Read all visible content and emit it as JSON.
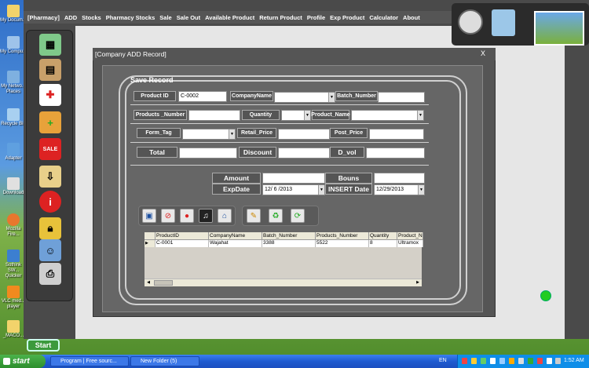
{
  "app_menu": [
    "[Pharmacy]",
    "ADD",
    "Stocks",
    "Pharmacy Stocks",
    "Sale",
    "Sale Out",
    "Available Product",
    "Return Product",
    "Profile",
    "Exp Product",
    "Calculator",
    "About"
  ],
  "desktop_icons": [
    "My Docum...",
    "My Compu...",
    "My Netwo... Places",
    "Recycle Bin",
    "Adapter",
    "Download",
    "Mozilla Fire...",
    "Sothink SW... Quicker",
    "VLC med... player",
    "_MACO..."
  ],
  "dialog": {
    "title": "[Company ADD Record]",
    "close": "X",
    "legend": "Save Record",
    "fields": {
      "product_id_label": "Product ID",
      "product_id_value": "C-0002",
      "company_name_label": "CompanyName",
      "company_name_value": "",
      "batch_number_label": "Batch_Number",
      "batch_number_value": "",
      "products_number_label": "Products _Number",
      "products_number_value": "",
      "quantity_label": "Quantity",
      "quantity_value": "",
      "product_name_label": "Product_Name",
      "product_name_value": "",
      "form_tag_label": "Form_Tag",
      "form_tag_value": "",
      "retail_price_label": "Retail_Price",
      "retail_price_value": "",
      "post_price_label": "Post_Price",
      "post_price_value": "",
      "total_label": "Total",
      "total_value": "",
      "discount_label": "Discount",
      "discount_value": "",
      "d_vol_label": "D_vol",
      "d_vol_value": "",
      "amount_label": "Amount",
      "amount_value": "",
      "bouns_label": "Bouns",
      "bouns_value": "",
      "exp_date_label": "ExpDate",
      "exp_date_value": "12/ 6 /2013",
      "insert_date_label": "INSERT Date",
      "insert_date_value": "12/29/2013"
    },
    "grid": {
      "columns": [
        "ProductID",
        "CompanyName",
        "Batch_Number",
        "Products_Number",
        "Quantity",
        "Product_N"
      ],
      "rows": [
        [
          "C-0001",
          "Wajahat",
          "3388",
          "5522",
          "8",
          "Ultramox"
        ]
      ]
    }
  },
  "start_app_button": "Start",
  "taskbar": {
    "start": "start",
    "tasks": [
      "Program | Free sourc...",
      "New Folder (5)"
    ],
    "lang": "EN",
    "clock": "1:52 AM"
  },
  "colors": {
    "status_dot": "#22cc22"
  }
}
